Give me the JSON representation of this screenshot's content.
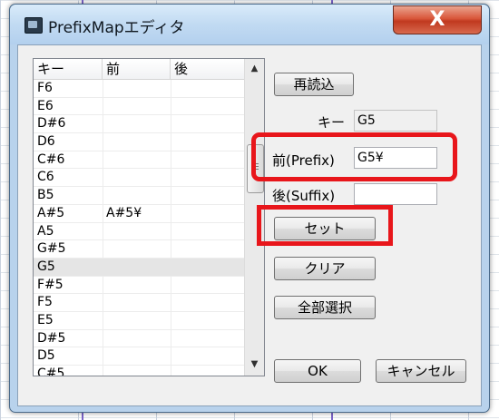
{
  "window": {
    "title": "PrefixMapエディタ",
    "close_label": "X"
  },
  "list": {
    "columns": [
      "キー",
      "前",
      "後"
    ],
    "rows": [
      {
        "key": "F6",
        "prefix": "",
        "suffix": ""
      },
      {
        "key": "E6",
        "prefix": "",
        "suffix": ""
      },
      {
        "key": "D#6",
        "prefix": "",
        "suffix": ""
      },
      {
        "key": "D6",
        "prefix": "",
        "suffix": ""
      },
      {
        "key": "C#6",
        "prefix": "",
        "suffix": ""
      },
      {
        "key": "C6",
        "prefix": "",
        "suffix": ""
      },
      {
        "key": "B5",
        "prefix": "",
        "suffix": ""
      },
      {
        "key": "A#5",
        "prefix": "A#5¥",
        "suffix": ""
      },
      {
        "key": "A5",
        "prefix": "",
        "suffix": ""
      },
      {
        "key": "G#5",
        "prefix": "",
        "suffix": ""
      },
      {
        "key": "G5",
        "prefix": "",
        "suffix": "",
        "selected": true
      },
      {
        "key": "F#5",
        "prefix": "",
        "suffix": ""
      },
      {
        "key": "F5",
        "prefix": "",
        "suffix": ""
      },
      {
        "key": "E5",
        "prefix": "",
        "suffix": ""
      },
      {
        "key": "D#5",
        "prefix": "",
        "suffix": ""
      },
      {
        "key": "D5",
        "prefix": "",
        "suffix": ""
      },
      {
        "key": "C#5",
        "prefix": "",
        "suffix": ""
      }
    ],
    "scroll_up": "▲",
    "scroll_down": "▼"
  },
  "buttons": {
    "reload": "再読込",
    "set": "セット",
    "clear": "クリア",
    "select_all": "全部選択",
    "ok": "OK",
    "cancel": "キャンセル"
  },
  "fields": {
    "key_label": "キー",
    "key_value": "G5",
    "prefix_label": "前(Prefix)",
    "prefix_value": "G5¥",
    "suffix_label": "後(Suffix)",
    "suffix_value": ""
  },
  "colors": {
    "highlight": "#e8161b",
    "titlebar": "#c1daf2",
    "close": "#c0391f"
  }
}
